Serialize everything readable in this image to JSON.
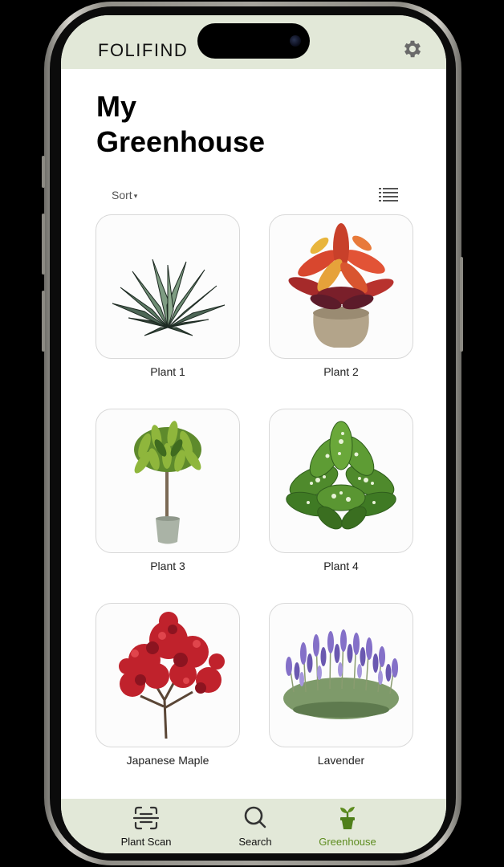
{
  "header": {
    "brand": "FOLIFIND",
    "settings_icon": "gear-icon"
  },
  "page": {
    "title": "My\nGreenhouse",
    "sort_label": "Sort",
    "sort_indicator": "▾",
    "view_icon": "list-view-icon"
  },
  "plants": [
    {
      "label": "Plant 1",
      "image": "agave-succulent"
    },
    {
      "label": "Plant 2",
      "image": "croton-potted-plant"
    },
    {
      "label": "Plant 3",
      "image": "ficus-tree-potted"
    },
    {
      "label": "Plant 4",
      "image": "dieffenbachia-leafy"
    },
    {
      "label": "Japanese Maple",
      "image": "japanese-maple-tree"
    },
    {
      "label": "Lavender",
      "image": "lavender-bush"
    }
  ],
  "tabbar": {
    "tabs": [
      {
        "label": "Plant Scan",
        "icon": "scan-icon",
        "active": false
      },
      {
        "label": "Search",
        "icon": "search-icon",
        "active": false
      },
      {
        "label": "Greenhouse",
        "icon": "potted-sprout-icon",
        "active": true
      }
    ]
  },
  "colors": {
    "bar_background": "#e2e8d8",
    "active_tab": "#5d8c1f"
  }
}
